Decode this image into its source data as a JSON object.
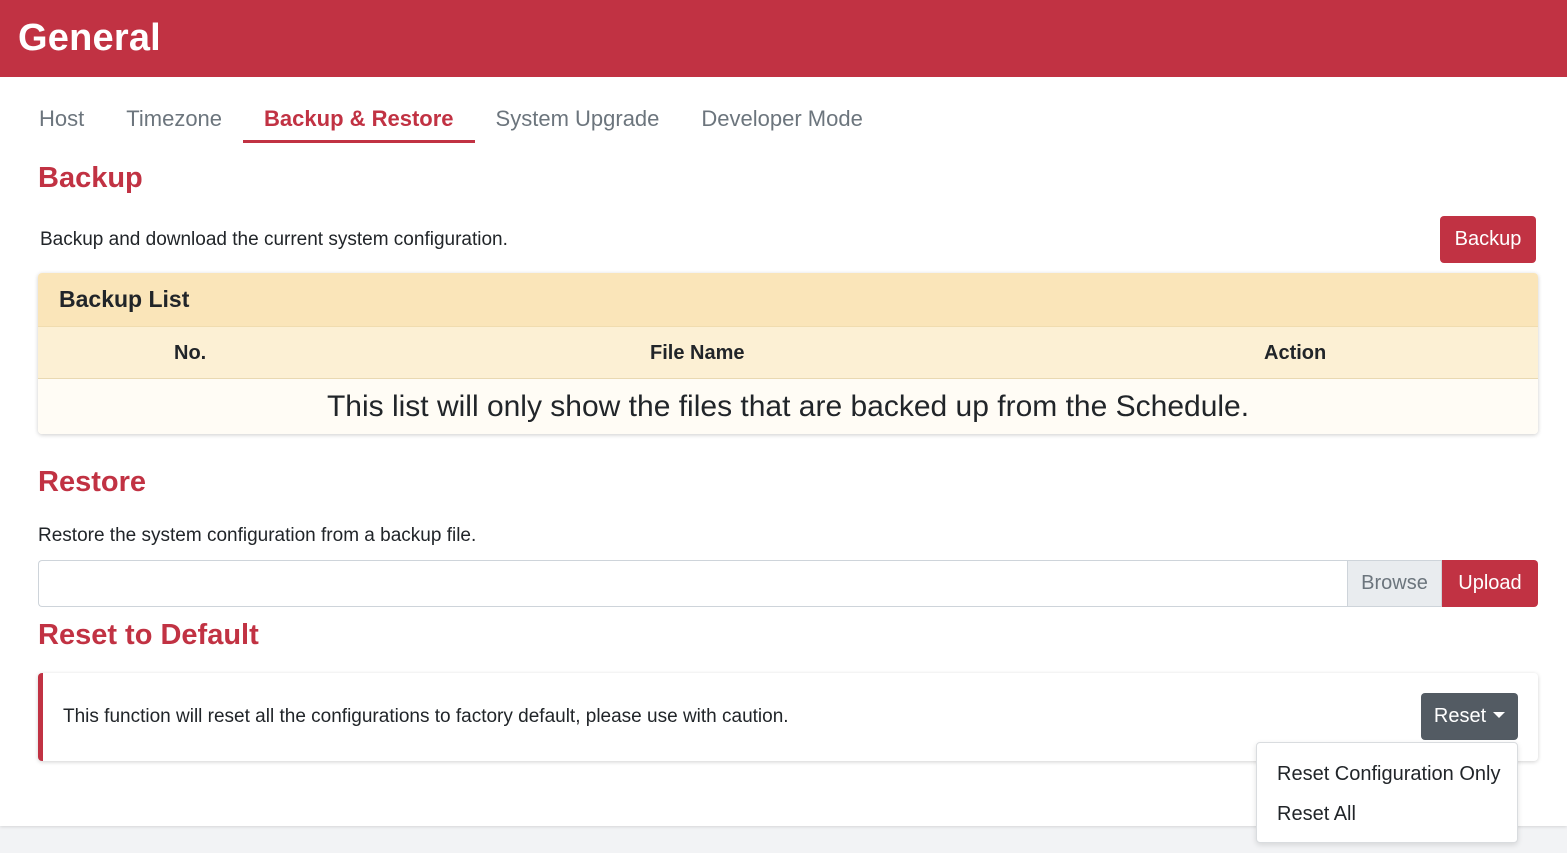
{
  "header": {
    "title": "General"
  },
  "tabs": [
    {
      "label": "Host"
    },
    {
      "label": "Timezone"
    },
    {
      "label": "Backup & Restore"
    },
    {
      "label": "System Upgrade"
    },
    {
      "label": "Developer Mode"
    }
  ],
  "active_tab": "Backup & Restore",
  "backup": {
    "title": "Backup",
    "description": "Backup and download the current system configuration.",
    "button_label": "Backup",
    "list": {
      "title": "Backup List",
      "columns": [
        "No.",
        "File Name",
        "Action"
      ],
      "empty_message": "This list will only show the files that are backed up from the Schedule."
    }
  },
  "restore": {
    "title": "Restore",
    "description": "Restore the system configuration from a backup file.",
    "file_value": "",
    "browse_label": "Browse",
    "upload_label": "Upload"
  },
  "reset": {
    "title": "Reset to Default",
    "message": "This function will reset all the configurations to factory default, please use with caution.",
    "button_label": "Reset",
    "menu": [
      "Reset Configuration Only",
      "Reset All"
    ]
  },
  "colors": {
    "brand": "#c13243",
    "dark_button": "#535b63",
    "list_header": "#fae5b9"
  }
}
